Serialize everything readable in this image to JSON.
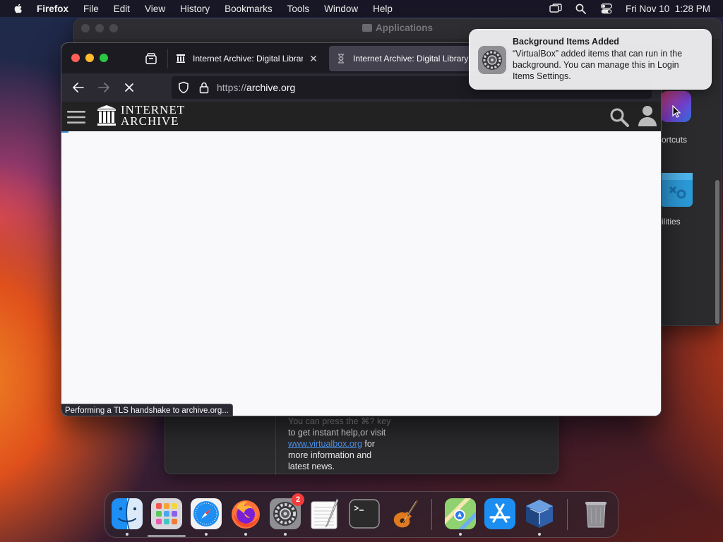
{
  "menubar": {
    "app_name": "Firefox",
    "items": [
      "File",
      "Edit",
      "View",
      "History",
      "Bookmarks",
      "Tools",
      "Window",
      "Help"
    ],
    "clock": "Fri Nov 10  1:28 PM"
  },
  "finder": {
    "title": "Applications",
    "visible_items": [
      "ortcuts",
      "ilities"
    ]
  },
  "firefox": {
    "tabs": [
      {
        "title": "Internet Archive: Digital Library",
        "active": false
      },
      {
        "title": "Internet Archive: Digital Library",
        "active": true
      }
    ],
    "url": {
      "scheme": "https://",
      "host": "archive.org"
    },
    "status": "Performing a TLS handshake to archive.org..."
  },
  "ia": {
    "logo_line1": "INTERNET",
    "logo_line2": "ARCHIVE"
  },
  "vbox": {
    "faded_line": "You can press the ⌘? key",
    "line1": "to get instant help,or visit",
    "link": "www.virtualbox.org",
    "after_link": " for",
    "line3": "more information and",
    "line4": "latest news."
  },
  "notification": {
    "title": "Background Items Added",
    "body": "“VirtualBox” added items that can run in the background. You can manage this in Login Items Settings."
  },
  "dock": {
    "apps": [
      "finder",
      "launchpad",
      "safari",
      "firefox",
      "system-settings",
      "textedit",
      "terminal",
      "garageband",
      "maps",
      "app-store",
      "virtualbox",
      "trash"
    ],
    "settings_badge": "2"
  },
  "colors": {
    "firefox_tabbar": "#1c1b22",
    "firefox_navbar": "#2b2a33",
    "link_blue": "#4e95ee",
    "badge_red": "#f43b3b"
  }
}
